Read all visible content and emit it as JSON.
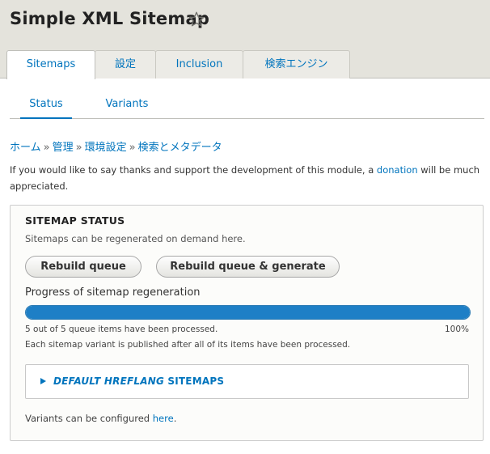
{
  "page": {
    "title": "Simple XML Sitemap",
    "star_icon": "star-outline-icon"
  },
  "primary_tabs": [
    {
      "label": "Sitemaps",
      "active": true
    },
    {
      "label": "設定",
      "active": false
    },
    {
      "label": "Inclusion",
      "active": false
    },
    {
      "label": "検索エンジン",
      "active": false
    }
  ],
  "secondary_tabs": [
    {
      "label": "Status",
      "active": true
    },
    {
      "label": "Variants",
      "active": false
    }
  ],
  "breadcrumb": {
    "items": [
      "ホーム",
      "管理",
      "環境設定",
      "検索とメタデータ"
    ],
    "separator": "»"
  },
  "donation": {
    "text_before": "If you would like to say thanks and support the development of this module, a ",
    "link": "donation",
    "text_after": " will be much appreciated."
  },
  "sitemap_status": {
    "legend": "SITEMAP STATUS",
    "description": "Sitemaps can be regenerated on demand here.",
    "buttons": {
      "rebuild_queue": "Rebuild queue",
      "rebuild_generate": "Rebuild queue & generate"
    },
    "progress": {
      "title": "Progress of sitemap regeneration",
      "value": 1.0,
      "message": "5 out of 5 queue items have been processed.",
      "percent_label": "100%",
      "note": "Each sitemap variant is published after all of its items have been processed."
    },
    "details": {
      "label_italic": "DEFAULT HREFLANG",
      "label_rest": " SITEMAPS",
      "arrow_icon": "triangle-right-icon"
    },
    "variants_note": {
      "text": "Variants can be configured ",
      "link": "here",
      "end": "."
    }
  },
  "colors": {
    "link": "#0074bd",
    "header_bg": "#e4e3dc",
    "progress_fill": "#1e7fc6"
  }
}
